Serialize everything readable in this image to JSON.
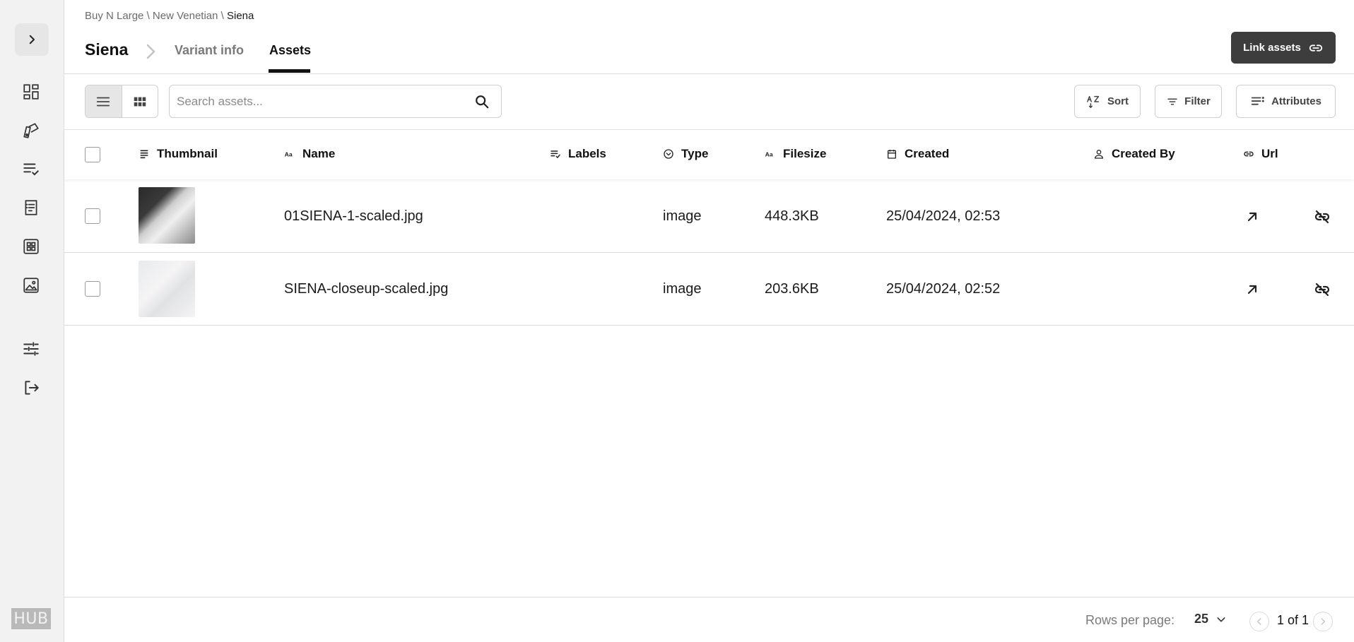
{
  "breadcrumb": {
    "items": [
      "Buy N Large",
      "New Venetian",
      "Siena"
    ],
    "separator": "\\"
  },
  "header": {
    "title": "Siena",
    "tabs": [
      {
        "label": "Variant info",
        "active": false
      },
      {
        "label": "Assets",
        "active": true
      }
    ],
    "link_assets_label": "Link assets"
  },
  "sidebar": {
    "icons": [
      "chevron-right-icon",
      "dashboard-icon",
      "swatch-icon",
      "list-check-icon",
      "receipt-icon",
      "grid-icon",
      "image-icon",
      "sliders-icon",
      "logout-icon"
    ],
    "logo_text": "HUB"
  },
  "toolbar": {
    "search_placeholder": "Search assets...",
    "sort_label": "Sort",
    "filter_label": "Filter",
    "attributes_label": "Attributes",
    "view_mode": "list"
  },
  "table": {
    "columns": [
      "Thumbnail",
      "Name",
      "Labels",
      "Type",
      "Filesize",
      "Created",
      "Created By",
      "Url"
    ],
    "rows": [
      {
        "name": "01SIENA-1-scaled.jpg",
        "labels": "",
        "type": "image",
        "filesize": "448.3KB",
        "created": "25/04/2024, 02:53",
        "created_by": ""
      },
      {
        "name": "SIENA-closeup-scaled.jpg",
        "labels": "",
        "type": "image",
        "filesize": "203.6KB",
        "created": "25/04/2024, 02:52",
        "created_by": ""
      }
    ]
  },
  "footer": {
    "rows_per_page_label": "Rows per page:",
    "rows_per_page_value": "25",
    "page_info": "1 of 1"
  }
}
